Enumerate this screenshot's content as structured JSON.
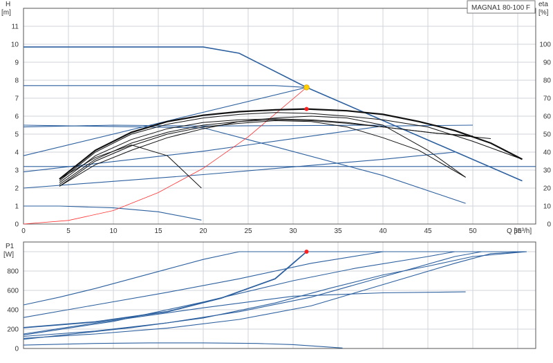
{
  "product_tag": "MAGNA1 80-100 F",
  "colors": {
    "curve": "#2b5f9e",
    "eta": "#111111",
    "system": "#ff3030",
    "duty": "#ff2020",
    "duty_eta": "#ffd000",
    "grid": "#cfd3da"
  },
  "chart_data": [
    {
      "type": "line",
      "ylabel": "H\n[m]",
      "y2label": "eta\n[%]",
      "xlabel": "Q [m³/h]",
      "xlim": [
        0,
        57
      ],
      "ylim": [
        0,
        12
      ],
      "y2lim": [
        0,
        120
      ],
      "grid": true,
      "xticks": [
        0,
        5,
        10,
        15,
        20,
        25,
        30,
        35,
        40,
        45,
        50,
        55
      ],
      "yticks": [
        0,
        1,
        2,
        3,
        4,
        5,
        6,
        7,
        8,
        9,
        10,
        11
      ],
      "y2ticks": [
        0,
        10,
        20,
        30,
        40,
        50,
        60,
        70,
        80,
        90,
        100
      ],
      "head_curves": [
        [
          [
            0,
            9.85
          ],
          [
            20,
            9.85
          ],
          [
            24,
            9.5
          ],
          [
            31.5,
            7.6
          ],
          [
            55.5,
            2.4
          ]
        ],
        [
          [
            0,
            7.7
          ],
          [
            28,
            7.7
          ],
          [
            31.5,
            7.6
          ]
        ],
        [
          [
            0,
            5.5
          ],
          [
            20,
            5.35
          ],
          [
            28,
            4.3
          ],
          [
            40,
            2.7
          ],
          [
            49.2,
            1.15
          ]
        ],
        [
          [
            0,
            3.2
          ],
          [
            57,
            3.2
          ]
        ],
        [
          [
            0,
            1.0
          ],
          [
            4,
            1.0
          ],
          [
            10,
            0.9
          ],
          [
            15,
            0.68
          ],
          [
            19.8,
            0.22
          ]
        ]
      ],
      "control_curves": [
        [
          [
            0,
            3.8
          ],
          [
            31.5,
            7.6
          ]
        ],
        [
          [
            0,
            2.9
          ],
          [
            20,
            4.05
          ],
          [
            40,
            5.45
          ],
          [
            50,
            5.5
          ]
        ],
        [
          [
            0,
            2.0
          ],
          [
            20,
            2.75
          ],
          [
            40,
            3.6
          ],
          [
            48,
            4.0
          ]
        ],
        [
          [
            0,
            5.4
          ],
          [
            10,
            5.5
          ],
          [
            20,
            5.45
          ],
          [
            40,
            5.5
          ]
        ]
      ],
      "eta_curves": [
        [
          [
            4,
            25
          ],
          [
            8,
            41
          ],
          [
            12,
            51
          ],
          [
            16,
            57
          ],
          [
            20,
            60.5
          ],
          [
            24,
            62.5
          ],
          [
            28,
            63.5
          ],
          [
            31.5,
            64
          ],
          [
            36,
            63
          ],
          [
            40,
            61
          ],
          [
            44,
            57
          ],
          [
            48,
            52
          ],
          [
            52,
            45
          ],
          [
            55.5,
            36
          ]
        ],
        [
          [
            4,
            24
          ],
          [
            8,
            40
          ],
          [
            12,
            50
          ],
          [
            16,
            55.5
          ],
          [
            20,
            59
          ],
          [
            24,
            61
          ],
          [
            28,
            62
          ],
          [
            32,
            61.5
          ],
          [
            36,
            60
          ],
          [
            40,
            58
          ],
          [
            45,
            54
          ],
          [
            50,
            46
          ],
          [
            55.5,
            36
          ]
        ],
        [
          [
            4,
            23
          ],
          [
            8,
            38
          ],
          [
            12,
            47
          ],
          [
            16,
            53
          ],
          [
            20,
            56.5
          ],
          [
            24,
            58
          ],
          [
            28,
            58.5
          ],
          [
            32,
            58
          ],
          [
            36,
            56.5
          ],
          [
            40,
            54
          ],
          [
            45,
            51
          ],
          [
            52,
            47.5
          ]
        ],
        [
          [
            4,
            22
          ],
          [
            8,
            36
          ],
          [
            12,
            45
          ],
          [
            16,
            51
          ],
          [
            20,
            55
          ],
          [
            24,
            57
          ],
          [
            28,
            58
          ],
          [
            32,
            57.5
          ],
          [
            36,
            56
          ],
          [
            40,
            54
          ],
          [
            46,
            50.5
          ],
          [
            50,
            49
          ]
        ],
        [
          [
            4,
            21
          ],
          [
            8,
            35
          ],
          [
            12,
            43.5
          ],
          [
            16,
            50
          ],
          [
            20,
            54
          ],
          [
            24,
            56
          ],
          [
            28,
            57.5
          ],
          [
            32,
            57
          ],
          [
            36,
            54
          ],
          [
            40,
            48
          ],
          [
            44,
            41
          ],
          [
            49.2,
            26
          ]
        ],
        [
          [
            4,
            25
          ],
          [
            8,
            37
          ],
          [
            12,
            44
          ],
          [
            16,
            38
          ],
          [
            19.8,
            20
          ]
        ],
        [
          [
            4,
            21
          ],
          [
            8,
            33
          ],
          [
            12,
            41
          ],
          [
            16,
            48
          ],
          [
            20,
            53
          ],
          [
            24,
            57
          ],
          [
            28,
            59
          ],
          [
            32,
            60
          ],
          [
            36,
            59
          ],
          [
            40,
            55
          ],
          [
            45,
            41
          ],
          [
            49.2,
            26
          ]
        ]
      ],
      "system_curve": [
        [
          0,
          0
        ],
        [
          5,
          0.2
        ],
        [
          10,
          0.75
        ],
        [
          15,
          1.75
        ],
        [
          20,
          3.1
        ],
        [
          25,
          4.85
        ],
        [
          31.5,
          7.6
        ]
      ],
      "duty_point": {
        "q": 31.5,
        "h": 7.6
      },
      "duty_eta_point": {
        "q": 31.5,
        "eta": 64
      }
    },
    {
      "type": "line",
      "ylabel": "P1\n[W]",
      "xlim": [
        0,
        57
      ],
      "ylim": [
        0,
        1100
      ],
      "grid": true,
      "xticks": [
        0,
        5,
        10,
        15,
        20,
        25,
        30,
        35,
        40,
        45,
        50,
        55
      ],
      "yticks": [
        0,
        200,
        400,
        600,
        800
      ],
      "power_curves": [
        [
          [
            0,
            450
          ],
          [
            4,
            530
          ],
          [
            8,
            620
          ],
          [
            12,
            720
          ],
          [
            16,
            820
          ],
          [
            20,
            920
          ],
          [
            24,
            1000
          ],
          [
            56,
            1000
          ]
        ],
        [
          [
            0,
            320
          ],
          [
            8,
            450
          ],
          [
            16,
            580
          ],
          [
            24,
            720
          ],
          [
            32,
            880
          ],
          [
            40,
            1000
          ],
          [
            56,
            1000
          ]
        ],
        [
          [
            0,
            215
          ],
          [
            8,
            275
          ],
          [
            16,
            380
          ],
          [
            22,
            520
          ],
          [
            28,
            720
          ],
          [
            31.5,
            1000
          ]
        ],
        [
          [
            0,
            125
          ],
          [
            8,
            180
          ],
          [
            16,
            265
          ],
          [
            24,
            380
          ],
          [
            32,
            530
          ],
          [
            40,
            740
          ],
          [
            48,
            950
          ],
          [
            51,
            1000
          ],
          [
            56,
            1000
          ]
        ],
        [
          [
            0,
            105
          ],
          [
            8,
            150
          ],
          [
            16,
            210
          ],
          [
            24,
            300
          ],
          [
            32,
            440
          ],
          [
            40,
            660
          ],
          [
            48,
            880
          ],
          [
            52,
            980
          ],
          [
            56,
            1000
          ]
        ],
        [
          [
            0,
            140
          ],
          [
            10,
            280
          ],
          [
            20,
            480
          ],
          [
            30,
            700
          ],
          [
            37,
            830
          ],
          [
            45,
            950
          ],
          [
            48,
            1000
          ],
          [
            56,
            1000
          ]
        ],
        [
          [
            0,
            150
          ],
          [
            10,
            290
          ],
          [
            20,
            420
          ],
          [
            30,
            540
          ],
          [
            40,
            575
          ],
          [
            49.2,
            585
          ]
        ],
        [
          [
            0,
            95
          ],
          [
            12,
            215
          ],
          [
            20,
            315
          ],
          [
            28,
            470
          ],
          [
            34,
            620
          ],
          [
            40,
            760
          ],
          [
            45,
            850
          ],
          [
            50,
            950
          ],
          [
            56,
            1000
          ]
        ],
        [
          [
            0,
            35
          ],
          [
            8,
            52
          ],
          [
            14,
            58
          ],
          [
            20,
            58
          ],
          [
            26,
            52
          ],
          [
            30,
            40
          ],
          [
            35.5,
            5
          ]
        ]
      ],
      "duty_point": {
        "q": 31.5,
        "p": 1000
      }
    }
  ],
  "panels": {
    "top": {
      "y_axis_title": "H",
      "y_axis_unit": "[m]",
      "y2_axis_title": "eta",
      "y2_axis_unit": "[%]",
      "x_ticks": [
        "0",
        "5",
        "10",
        "15",
        "20",
        "25",
        "30",
        "35",
        "40",
        "45",
        "50",
        "55"
      ],
      "y_ticks": [
        "0",
        "1",
        "2",
        "3",
        "4",
        "5",
        "6",
        "7",
        "8",
        "9",
        "10",
        "11"
      ],
      "y2_ticks": [
        "0",
        "10",
        "20",
        "30",
        "40",
        "50",
        "60",
        "70",
        "80",
        "90",
        "100"
      ],
      "x_axis_label": "Q [m³/h]"
    },
    "bottom": {
      "y_axis_title": "P1",
      "y_axis_unit": "[W]",
      "y_ticks": [
        "0",
        "200",
        "400",
        "600",
        "800"
      ]
    }
  }
}
